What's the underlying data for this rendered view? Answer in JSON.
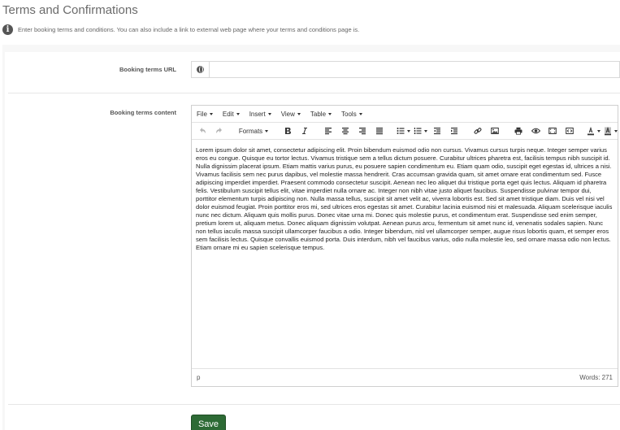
{
  "page": {
    "title": "Terms and Confirmations",
    "info": "Enter booking terms and conditions. You can also include a link to external web page where your terms and conditions page is."
  },
  "url_field": {
    "label": "Booking terms URL",
    "value": "",
    "placeholder": ""
  },
  "content_field": {
    "label": "Booking terms content"
  },
  "editor": {
    "menus": [
      "File",
      "Edit",
      "Insert",
      "View",
      "Table",
      "Tools"
    ],
    "formats_label": "Formats",
    "text": "Lorem ipsum dolor sit amet, consectetur adipiscing elit. Proin bibendum euismod odio non cursus. Vivamus cursus turpis neque. Integer semper varius eros eu congue. Quisque eu tortor lectus. Vivamus tristique sem a tellus dictum posuere. Curabitur ultrices pharetra est, facilisis tempus nibh suscipit id. Nulla dignissim placerat ipsum. Etiam mattis varius purus, eu posuere sapien condimentum eu. Etiam quam odio, suscipit eget egestas id, ultrices a nisi. Vivamus facilisis sem nec purus dapibus, vel molestie massa hendrerit. Cras accumsan gravida quam, sit amet ornare erat condimentum sed. Fusce adipiscing imperdiet imperdiet. Praesent commodo consectetur suscipit. Aenean nec leo aliquet dui tristique porta eget quis lectus. Aliquam id pharetra felis. Vestibulum suscipit tellus elit, vitae imperdiet nulla ornare ac. Integer non nibh vitae justo aliquet faucibus. Suspendisse pulvinar tempor dui, porttitor elementum turpis adipiscing non. Nulla massa tellus, suscipit sit amet velit ac, viverra lobortis est. Sed sit amet tristique diam. Duis vel nisi vel dolor euismod feugiat. Proin porttitor eros mi, sed ultrices eros egestas sit amet. Curabitur lacinia euismod nisi et malesuada. Aliquam scelerisque iaculis nunc nec dictum. Aliquam quis mollis purus. Donec vitae urna mi. Donec quis molestie purus, et condimentum erat. Suspendisse sed enim semper, pretium lorem ut, aliquam metus. Donec aliquam dignissim volutpat. Aenean purus arcu, fermentum sit amet nunc id, venenatis sodales sapien. Nunc non tellus iaculis massa suscipit ullamcorper faucibus a odio. Integer bibendum, nisl vel ullamcorper semper, augue risus lobortis quam, et semper eros sem facilisis lectus. Quisque convallis euismod porta. Duis interdum, nibh vel faucibus varius, odio nulla molestie leo, sed ornare massa odio non lectus. Etiam ornare mi eu sapien scelerisque tempus.",
    "status_path": "p",
    "word_count": "Words: 271"
  },
  "actions": {
    "save_label": "Save"
  },
  "colors": {
    "save_button": "#2d6a35",
    "title": "#6b6b6b"
  }
}
